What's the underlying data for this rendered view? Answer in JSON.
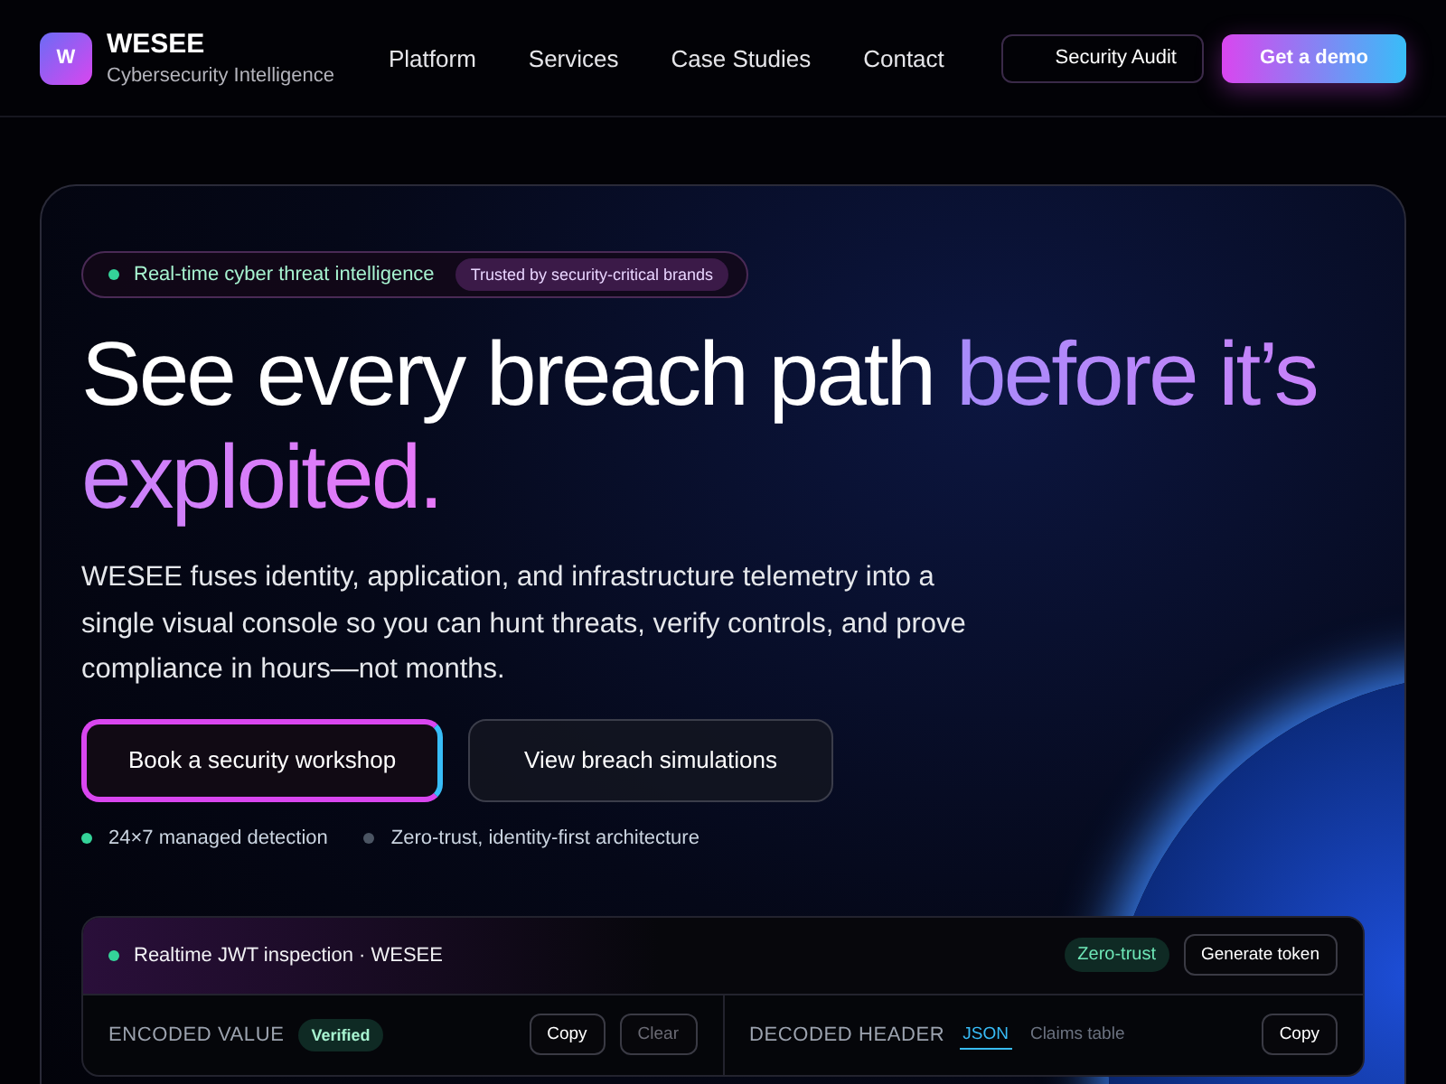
{
  "brand": {
    "logo": "W",
    "name": "WESEE",
    "tagline": "Cybersecurity Intelligence"
  },
  "nav": [
    {
      "label": "Platform"
    },
    {
      "label": "Services"
    },
    {
      "label": "Case Studies"
    },
    {
      "label": "Contact"
    }
  ],
  "header_buttons": [
    {
      "label": "Security Audit",
      "kind": "outline"
    },
    {
      "label": "Get a demo",
      "kind": "gradient"
    }
  ],
  "hero": {
    "pill": {
      "text": "Real-time cyber threat intelligence",
      "badge": "Trusted by security-critical brands"
    },
    "heading_lead": "See every breach path",
    "heading_accent": "before it’s exploited.",
    "body": "WESEE fuses identity, application, and infrastructure telemetry into a single visual console so you can hunt threats, verify controls, and prove compliance in hours—not months.",
    "buttons": [
      {
        "label": "Book a security workshop",
        "kind": "primary"
      },
      {
        "label": "View breach simulations",
        "kind": "secondary"
      }
    ],
    "features": [
      {
        "text": "24×7 managed detection",
        "color": "#34d399"
      },
      {
        "text": "Zero-trust, identity-first architecture",
        "color": "#4b5563"
      }
    ]
  },
  "console": {
    "title": "Realtime JWT inspection · WESEE",
    "badge": "Zero-trust",
    "action": "Generate token",
    "panes": [
      {
        "label": "ENCODED VALUE",
        "badge": "Verified",
        "buttons": [
          {
            "label": "Copy",
            "disabled": false
          },
          {
            "label": "Clear",
            "disabled": true
          }
        ]
      },
      {
        "label": "DECODED HEADER",
        "tabs": [
          {
            "label": "JSON",
            "selected": true
          },
          {
            "label": "Claims table",
            "selected": false
          }
        ],
        "buttons": [
          {
            "label": "Copy",
            "disabled": false
          }
        ]
      }
    ]
  }
}
